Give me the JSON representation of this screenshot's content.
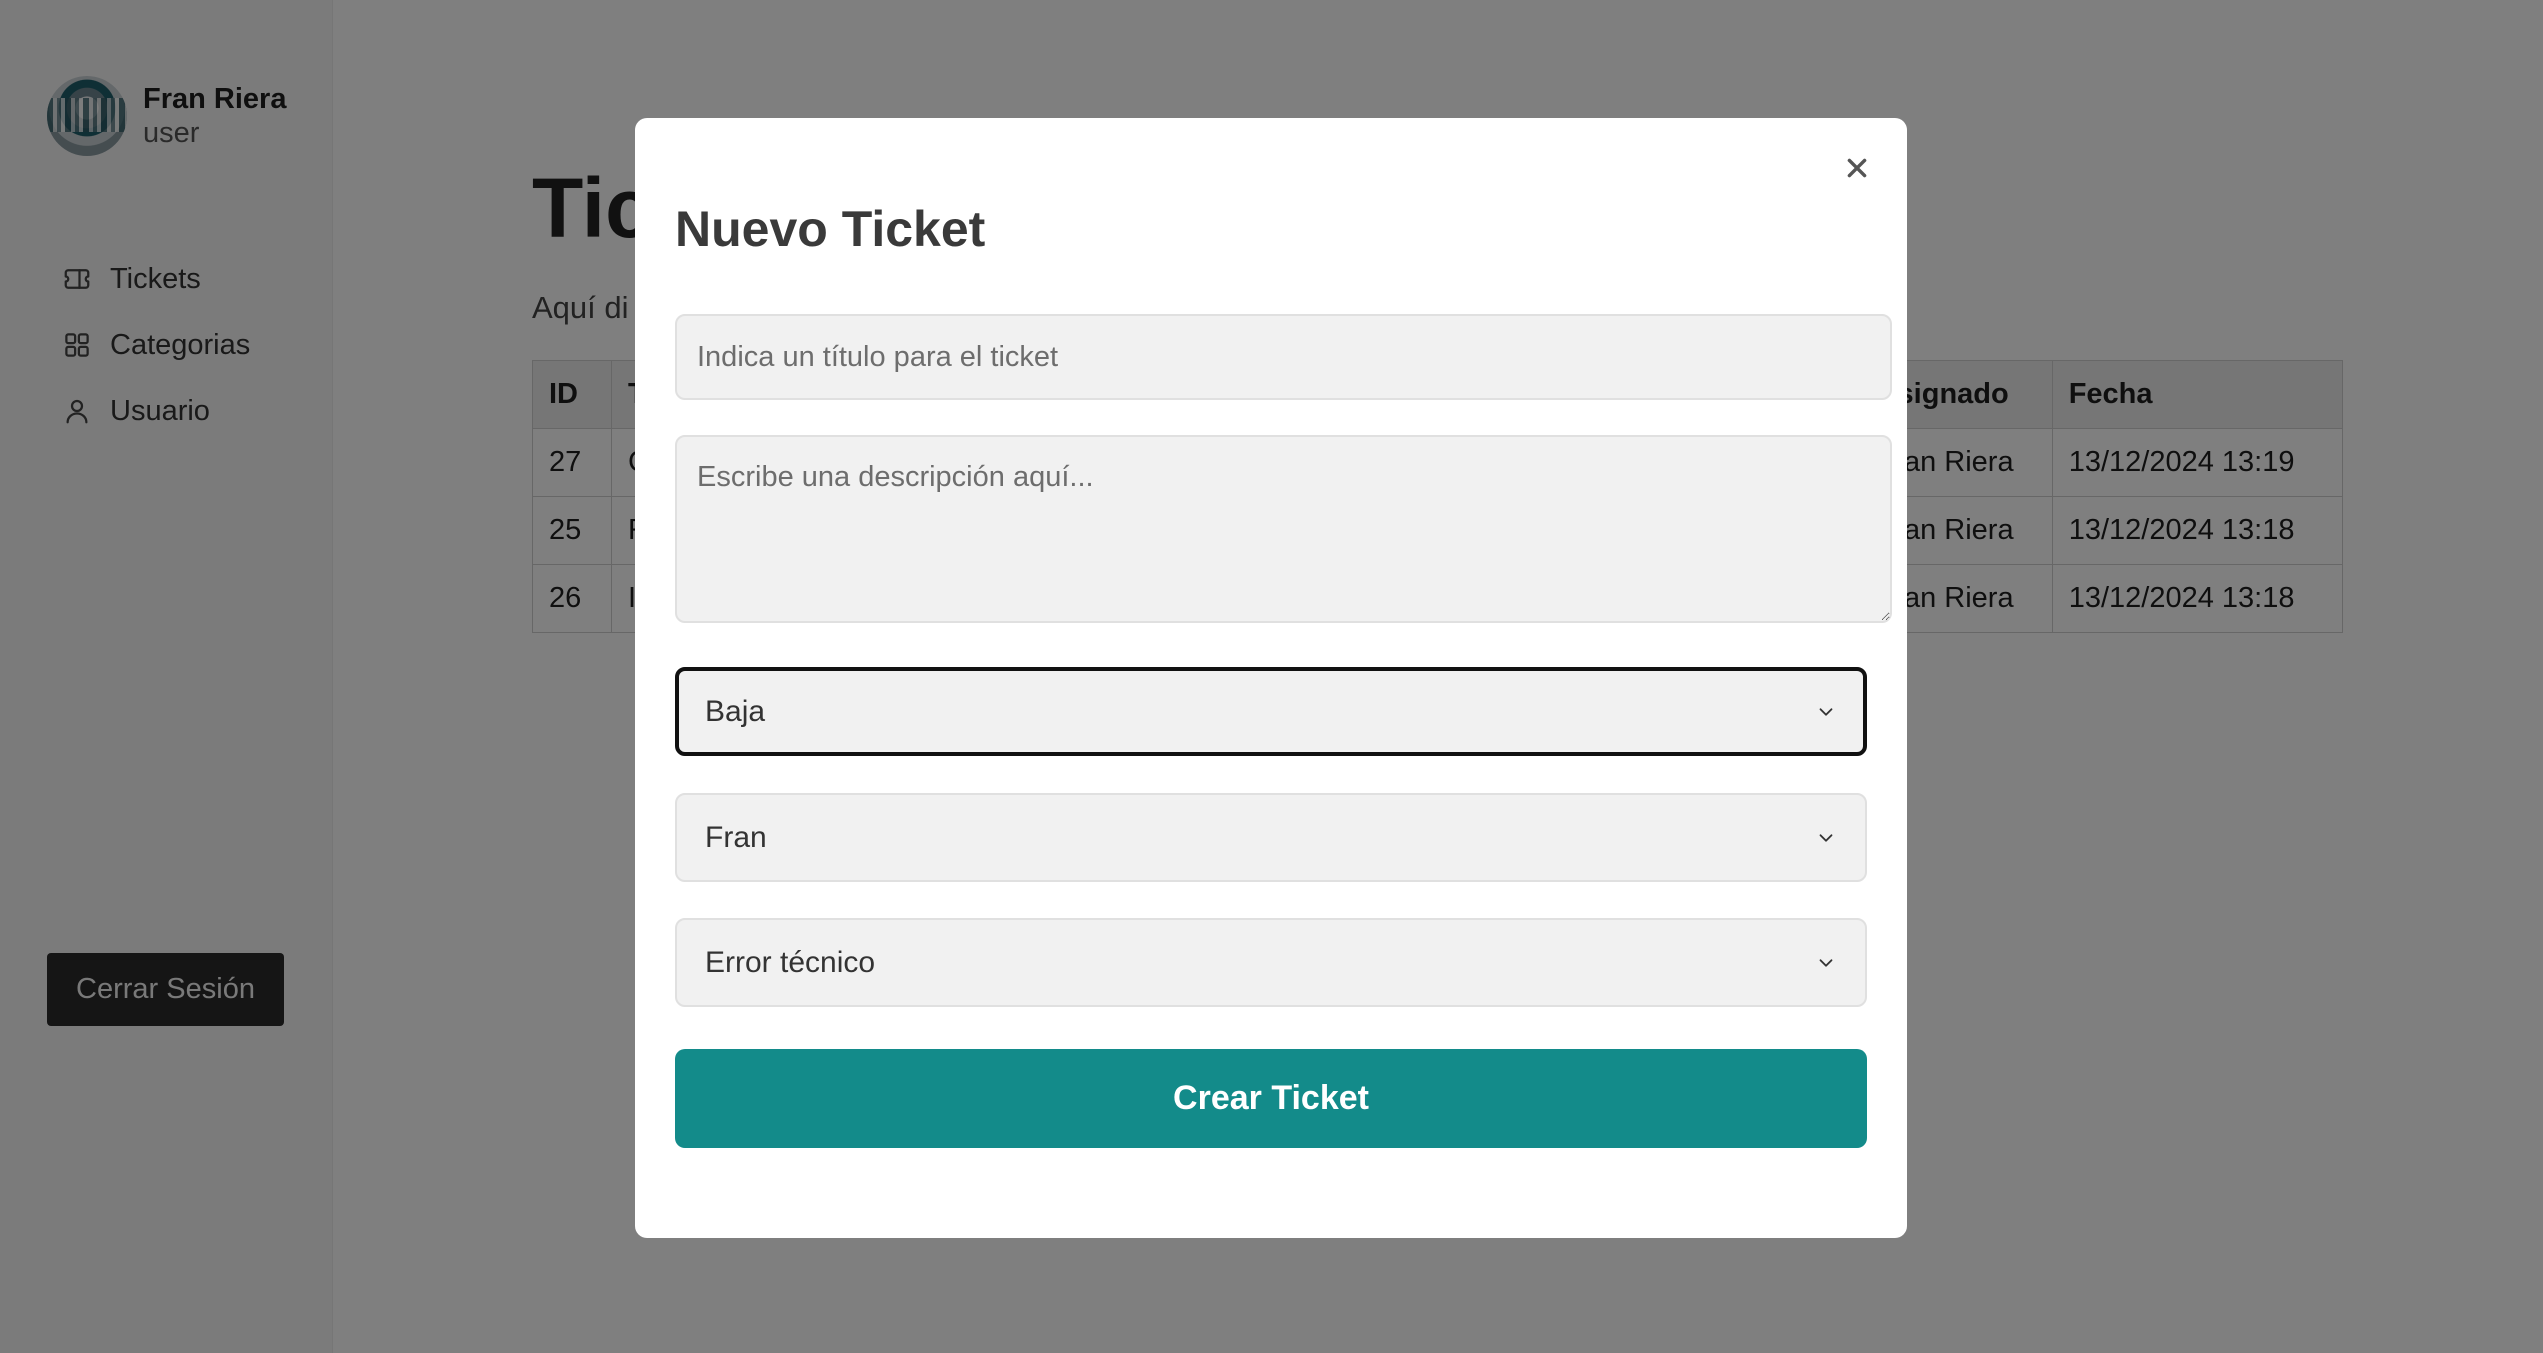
{
  "sidebar": {
    "user": {
      "name": "Fran Riera",
      "role": "user"
    },
    "nav": [
      {
        "label": "Tickets",
        "icon": "ticket-icon"
      },
      {
        "label": "Categorias",
        "icon": "grid-icon"
      },
      {
        "label": "Usuario",
        "icon": "user-icon"
      }
    ],
    "logout_label": "Cerrar Sesión"
  },
  "main": {
    "title": "Tic",
    "description": "Aquí di",
    "table": {
      "headers": [
        "ID",
        "T",
        "Asignado",
        "Fecha"
      ],
      "rows": [
        {
          "id": "27",
          "title": "C",
          "assigned": "Fran Riera",
          "date": "13/12/2024 13:19"
        },
        {
          "id": "25",
          "title": "R",
          "assigned": "Fran Riera",
          "date": "13/12/2024 13:18"
        },
        {
          "id": "26",
          "title": "I",
          "assigned": "Fran Riera",
          "date": "13/12/2024 13:18"
        }
      ]
    }
  },
  "modal": {
    "title": "Nuevo Ticket",
    "title_placeholder": "Indica un título para el ticket",
    "description_placeholder": "Escribe una descripción aquí...",
    "priority_value": "Baja",
    "assignee_value": "Fran",
    "category_value": "Error técnico",
    "submit_label": "Crear Ticket"
  },
  "colors": {
    "accent": "#138b8a",
    "overlay": "rgba(0,0,0,0.5)",
    "logout_bg": "#2b2b2b"
  }
}
